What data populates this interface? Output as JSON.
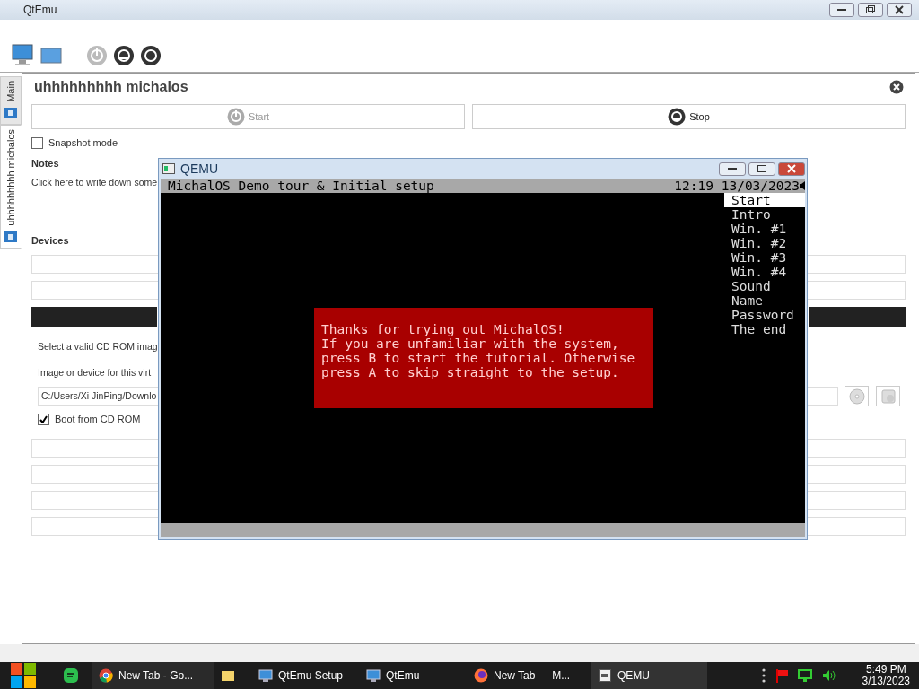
{
  "main_window": {
    "title": "QtEmu"
  },
  "side_tabs": [
    {
      "label": "Main",
      "selected": false
    },
    {
      "label": "uhhhhhhhhh michalos",
      "selected": true
    }
  ],
  "machine": {
    "name": "uhhhhhhhhh michalos",
    "buttons": [
      {
        "label": "Start",
        "disabled": true
      },
      {
        "label": "Stop",
        "disabled": false
      }
    ],
    "snapshot": {
      "label": "Snapshot mode",
      "checked": false
    },
    "notes_label": "Notes",
    "notes_text": "Click here to write down some",
    "devices_label": "Devices",
    "cdrom": {
      "hint": "Select a valid CD ROM imag",
      "image_label": "Image or device for this virt",
      "path": "C:/Users/Xi JinPing/Downlo",
      "boot": {
        "label": "Boot from CD ROM",
        "checked": true
      }
    }
  },
  "qemu": {
    "title": "QEMU",
    "header": "MichalOS Demo tour & Initial setup",
    "clock": "12:19 13/03/2023",
    "menu": [
      {
        "label": "Start",
        "selected": true
      },
      {
        "label": "Intro",
        "selected": false
      },
      {
        "label": "Win. #1",
        "selected": false
      },
      {
        "label": "Win. #2",
        "selected": false
      },
      {
        "label": "Win. #3",
        "selected": false
      },
      {
        "label": "Win. #4",
        "selected": false
      },
      {
        "label": "Sound",
        "selected": false
      },
      {
        "label": "Name",
        "selected": false
      },
      {
        "label": "Password",
        "selected": false
      },
      {
        "label": "The end",
        "selected": false
      }
    ],
    "dialog": [
      "Thanks for trying out MichalOS!",
      "If you are unfamiliar with the system,",
      "press B to start the tutorial. Otherwise",
      "press A to skip straight to the setup."
    ]
  },
  "taskbar": {
    "items": [
      {
        "kind": "chrome",
        "label": "New Tab - Go...",
        "selected": false
      },
      {
        "kind": "folder",
        "selected": false
      },
      {
        "kind": "qtsetup",
        "label": "QtEmu Setup",
        "selected": false
      },
      {
        "kind": "qtemu",
        "label": "QtEmu",
        "selected": false
      },
      {
        "kind": "firefox",
        "label": "New Tab — M...",
        "selected": false
      },
      {
        "kind": "qemu",
        "label": "QEMU",
        "selected": true
      }
    ],
    "time": "5:49 PM",
    "date": "3/13/2023"
  }
}
